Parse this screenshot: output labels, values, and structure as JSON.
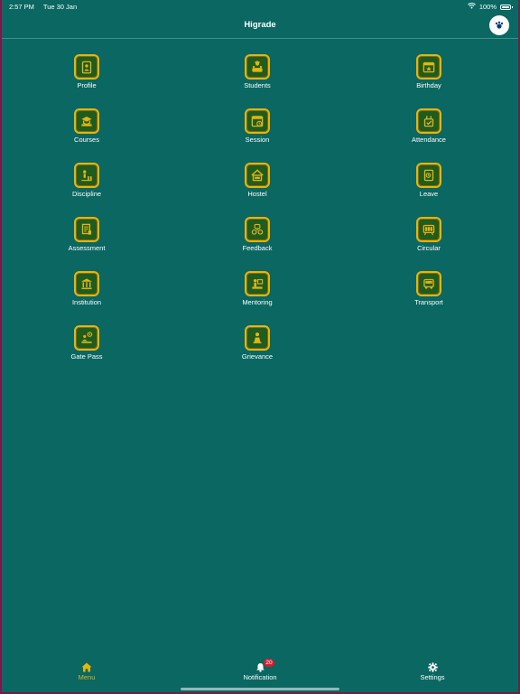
{
  "status_bar": {
    "time": "2:57 PM",
    "date": "Tue 30 Jan",
    "battery": "100%"
  },
  "header": {
    "title": "Higrade"
  },
  "menu": {
    "items": [
      {
        "label": "Profile",
        "icon": "profile-icon"
      },
      {
        "label": "Students",
        "icon": "students-icon"
      },
      {
        "label": "Birthday",
        "icon": "birthday-icon"
      },
      {
        "label": "Courses",
        "icon": "courses-icon"
      },
      {
        "label": "Session",
        "icon": "session-icon"
      },
      {
        "label": "Attendance",
        "icon": "attendance-icon"
      },
      {
        "label": "Discipline",
        "icon": "discipline-icon"
      },
      {
        "label": "Hostel",
        "icon": "hostel-icon"
      },
      {
        "label": "Leave",
        "icon": "leave-icon"
      },
      {
        "label": "Assessment",
        "icon": "assessment-icon"
      },
      {
        "label": "Feedback",
        "icon": "feedback-icon"
      },
      {
        "label": "Circular",
        "icon": "circular-icon"
      },
      {
        "label": "Institution",
        "icon": "institution-icon"
      },
      {
        "label": "Mentoring",
        "icon": "mentoring-icon"
      },
      {
        "label": "Transport",
        "icon": "transport-icon"
      },
      {
        "label": "Gate Pass",
        "icon": "gate-pass-icon"
      },
      {
        "label": "Grievance",
        "icon": "grievance-icon"
      }
    ]
  },
  "tab_bar": {
    "menu": "Menu",
    "notification": "Notification",
    "notification_count": "20",
    "settings": "Settings"
  },
  "colors": {
    "background": "#0a6762",
    "accent": "#e3b50e",
    "badge": "#d02030"
  }
}
